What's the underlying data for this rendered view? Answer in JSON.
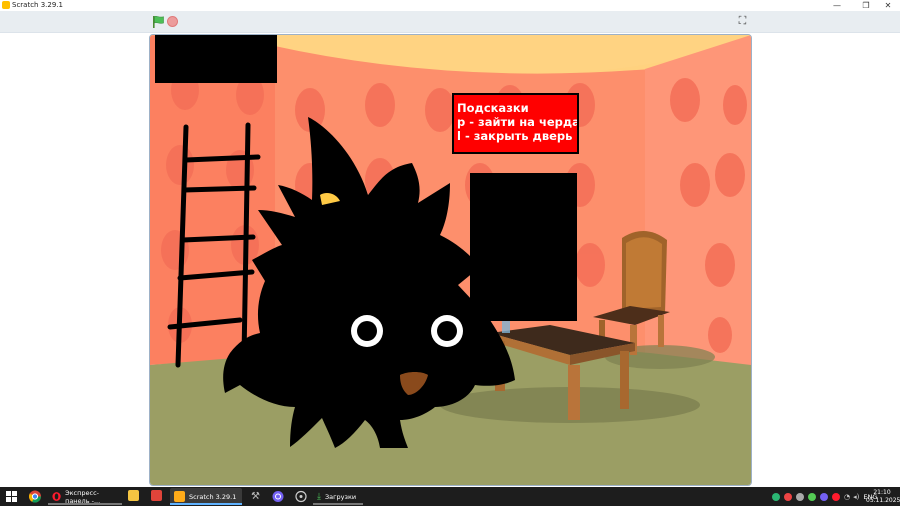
{
  "window": {
    "title": "Scratch 3.29.1"
  },
  "window_controls": {
    "minimize": "—",
    "maximize": "❐",
    "close": "✕"
  },
  "toolbar": {
    "green_flag_icon": "green-flag-icon",
    "stop_icon": "stop-icon",
    "fullscreen_icon": "⛶"
  },
  "stage": {
    "hint_lines": [
      "Подсказки",
      "p - зайти на чердак",
      "l - закрыть дверь"
    ]
  },
  "taskbar": {
    "apps": [
      {
        "name": "start-icon"
      },
      {
        "name": "chrome-icon"
      },
      {
        "name": "opera-icon",
        "label": "Экспресс-панель -..."
      },
      {
        "name": "file-explorer-icon"
      },
      {
        "name": "game-app-icon"
      },
      {
        "name": "scratch-icon",
        "label": "Scratch 3.29.1"
      },
      {
        "name": "tools-icon"
      },
      {
        "name": "viber-icon"
      },
      {
        "name": "app-circle-icon"
      },
      {
        "name": "downloads-icon",
        "label": "Загрузки"
      }
    ],
    "language": "ENG",
    "time": "21:10",
    "date": "05.11.2025"
  },
  "colors": {
    "wall": "#fd8c6c",
    "ceiling": "#ffd27f",
    "floor": "#9b9e64",
    "hint_bg": "#ff0000",
    "toolbar": "#e8edf1",
    "taskbar": "#1d1d1d"
  }
}
